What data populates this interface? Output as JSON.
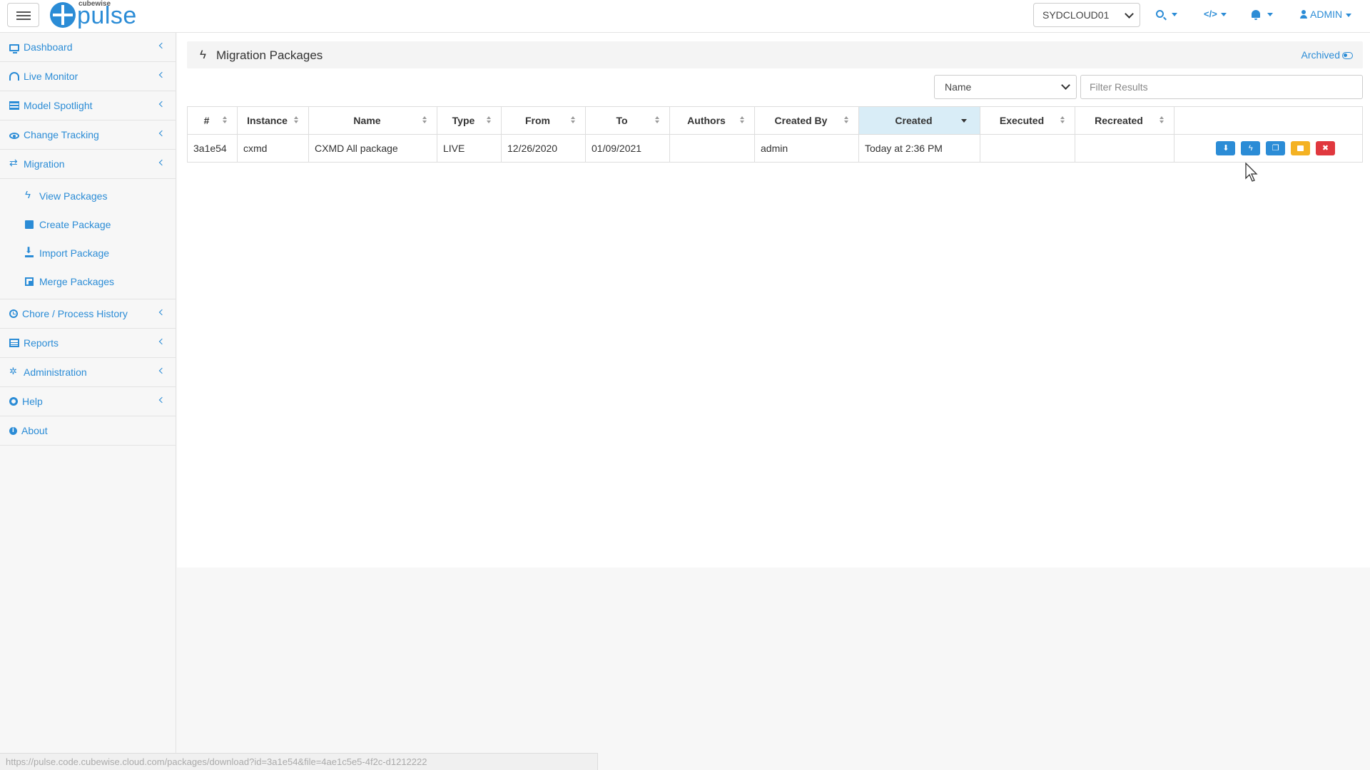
{
  "brand": {
    "small": "cubewise",
    "big": "pulse"
  },
  "header": {
    "server": "SYDCLOUD01",
    "code_icon": "</>",
    "user": "ADMIN"
  },
  "sidebar": {
    "items": [
      {
        "label": "Dashboard",
        "icon": "monitor-icon"
      },
      {
        "label": "Live Monitor",
        "icon": "gauge-icon"
      },
      {
        "label": "Model Spotlight",
        "icon": "list-icon"
      },
      {
        "label": "Change Tracking",
        "icon": "eye-icon"
      },
      {
        "label": "Migration",
        "icon": "exchange-icon"
      },
      {
        "label": "Chore / Process History",
        "icon": "clock-icon"
      },
      {
        "label": "Reports",
        "icon": "table-icon"
      },
      {
        "label": "Administration",
        "icon": "cogs-icon"
      },
      {
        "label": "Help",
        "icon": "life-ring-icon"
      },
      {
        "label": "About",
        "icon": "info-icon"
      }
    ],
    "migration_sub": [
      {
        "label": "View Packages",
        "icon": "bolt-icon"
      },
      {
        "label": "Create Package",
        "icon": "archive-icon"
      },
      {
        "label": "Import Package",
        "icon": "download-icon"
      },
      {
        "label": "Merge Packages",
        "icon": "copy-icon"
      }
    ]
  },
  "main": {
    "title": "Migration Packages",
    "archived": "Archived",
    "sort_select": "Name",
    "filter_placeholder": "Filter Results",
    "columns": [
      "#",
      "Instance",
      "Name",
      "Type",
      "From",
      "To",
      "Authors",
      "Created By",
      "Created",
      "Executed",
      "Recreated"
    ],
    "rows": [
      {
        "id": "3a1e54",
        "instance": "cxmd",
        "name": "CXMD All package",
        "type": "LIVE",
        "from": "12/26/2020",
        "to": "01/09/2021",
        "authors": "",
        "created_by": "admin",
        "created": "Today at 2:36 PM",
        "executed": "",
        "recreated": ""
      }
    ]
  },
  "colors": {
    "accent": "#2b8cd6",
    "warning": "#f4b223",
    "danger": "#e0383e",
    "sorted_header": "#d9edf7"
  },
  "status_url": "https://pulse.code.cubewise.cloud.com/packages/download?id=3a1e54&file=4ae1c5e5-4f2c-d1212222"
}
